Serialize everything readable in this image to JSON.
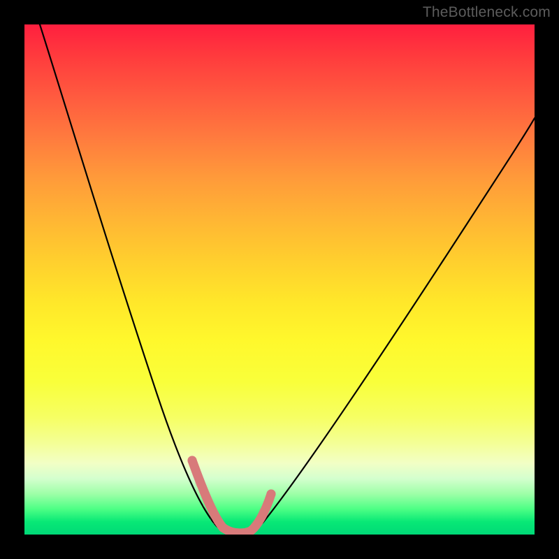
{
  "watermark": "TheBottleneck.com",
  "chart_data": {
    "type": "line",
    "title": "",
    "xlabel": "",
    "ylabel": "",
    "xlim": [
      0,
      100
    ],
    "ylim": [
      0,
      100
    ],
    "grid": false,
    "legend": false,
    "series": [
      {
        "name": "bottleneck-curve",
        "x": [
          3,
          6,
          10,
          14,
          18,
          22,
          26,
          30,
          33,
          35,
          37,
          39,
          41,
          43,
          46,
          50,
          55,
          60,
          66,
          72,
          80,
          88,
          96,
          100
        ],
        "y": [
          100,
          90,
          78,
          66,
          55,
          44,
          33,
          22,
          14,
          8,
          3,
          1,
          0,
          0,
          1,
          4,
          10,
          17,
          25,
          33,
          44,
          54,
          63,
          68
        ]
      }
    ],
    "annotations": [
      {
        "name": "valley-marker",
        "type": "scatter-band",
        "x": [
          33,
          34,
          35,
          36,
          37,
          38,
          39,
          40,
          41,
          42,
          43,
          44,
          45,
          46,
          47
        ],
        "y": [
          13,
          10,
          8,
          5,
          3,
          1.5,
          0.6,
          0.2,
          0.2,
          0.5,
          1,
          2.5,
          5,
          9,
          14
        ],
        "color": "#d87a7a"
      }
    ],
    "background_gradient": {
      "top": "#ff1f3f",
      "mid": "#ffe62a",
      "bottom": "#00d977"
    }
  }
}
